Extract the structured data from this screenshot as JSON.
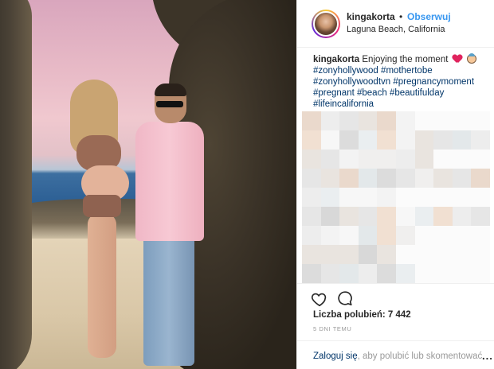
{
  "post": {
    "username": "kingakorta",
    "separator": "•",
    "follow_label": "Obserwuj",
    "location": "Laguna Beach, California",
    "caption_user": "kingakorta",
    "caption_text": "Enjoying the moment",
    "caption_emojis": [
      "red-heart-icon",
      "baby-emoji-icon"
    ],
    "hashtags": [
      "#zonyhollywood",
      "#mothertobe",
      "#zonyhollywoodtvn",
      "#pregnancymoment",
      "#pregnant",
      "#beach",
      "#beautifulday",
      "#lifeincalifornia"
    ],
    "likes_text": "Liczba polubień: 7 442",
    "time_text": "5 DNI TEMU",
    "login_link": "Zaloguj się",
    "login_rest": ", aby polubić lub skomentować.",
    "more_label": "..."
  },
  "colors": {
    "accent": "#3897f0",
    "hashtag": "#003569",
    "muted": "#999999",
    "text": "#262626",
    "divider": "#efefef"
  },
  "comments_blurred": true
}
